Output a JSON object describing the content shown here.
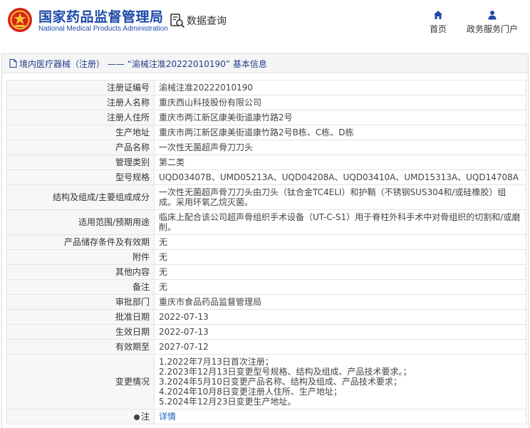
{
  "header": {
    "logo_cn": "国家药品监督管理局",
    "logo_en": "National Medical Products Administration",
    "search_label": "数据查询",
    "nav": [
      {
        "label": "首页",
        "icon": "home-icon"
      },
      {
        "label": "政务服务门户",
        "icon": "user-icon"
      }
    ]
  },
  "panel": {
    "title": "境内医疗器械（注册） —— “渝械注准20222010190” 基本信息"
  },
  "rows": [
    {
      "label": "注册证编号",
      "value": "渝械注准20222010190"
    },
    {
      "label": "注册人名称",
      "value": "重庆西山科技股份有限公司"
    },
    {
      "label": "注册人住所",
      "value": "重庆市两江新区康美街道康竹路2号"
    },
    {
      "label": "生产地址",
      "value": "重庆市两江新区康美街道康竹路2号B栋、C栋、D栋"
    },
    {
      "label": "产品名称",
      "value": "一次性无菌超声骨刀刀头"
    },
    {
      "label": "管理类别",
      "value": "第二类"
    },
    {
      "label": "型号规格",
      "value": "UQD03407B、UMD05213A、UQD04208A、UQD03410A、UMD15313A、UQD14708A"
    },
    {
      "label": "结构及组成/主要组成成分",
      "value": "一次性无菌超声骨刀刀头由刀头（钛合金TC4ELI）和护鞘（不锈钢SUS304和/或硅橡胶）组成。采用环氧乙烷灭菌。"
    },
    {
      "label": "适用范围/预期用途",
      "value": "临床上配合该公司超声骨组织手术设备（UT-C-S1）用于脊柱外科手术中对骨组织的切割和/或磨削。"
    },
    {
      "label": "产品储存条件及有效期",
      "value": "无"
    },
    {
      "label": "附件",
      "value": "无"
    },
    {
      "label": "其他内容",
      "value": "无"
    },
    {
      "label": "备注",
      "value": "无"
    },
    {
      "label": "审批部门",
      "value": "重庆市食品药品监督管理局"
    },
    {
      "label": "批准日期",
      "value": "2022-07-13"
    },
    {
      "label": "生效日期",
      "value": "2022-07-13"
    },
    {
      "label": "有效期至",
      "value": "2027-07-12"
    },
    {
      "label": "变更情况",
      "value": "1.2022年7月13日首次注册；\n2.2023年12月13日变更型号规格、结构及组成、产品技术要求。；\n3.2024年5月10日变更产品名称、结构及组成、产品技术要求；\n4.2024年10月8日变更注册人住所、生产地址；\n5.2024年12月23日变更生产地址。"
    }
  ],
  "note": {
    "label": "注",
    "link": "详情"
  },
  "colors": {
    "brand_blue": "#1d4aa8",
    "emblem_red": "#d7231a",
    "link": "#1d62c4"
  }
}
